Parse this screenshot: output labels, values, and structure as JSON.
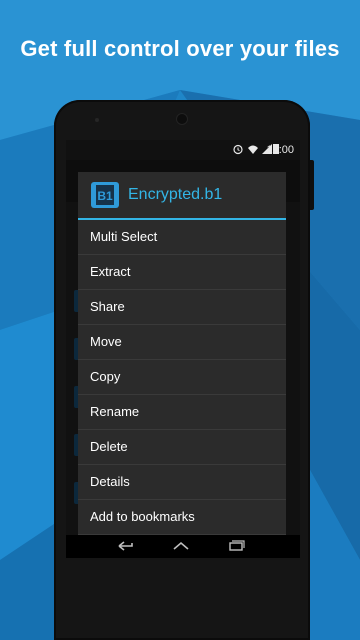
{
  "headline": "Get full control over your files",
  "status_bar": {
    "time": "10:00",
    "icons": [
      "alarm-icon",
      "wifi-icon",
      "signal-icon",
      "battery-icon"
    ]
  },
  "dialog": {
    "file_icon_text": "B1",
    "title": "Encrypted.b1",
    "menu_items": [
      "Multi Select",
      "Extract",
      "Share",
      "Move",
      "Copy",
      "Rename",
      "Delete",
      "Details",
      "Add to bookmarks"
    ]
  },
  "nav_bar": {
    "icons": [
      "back-icon",
      "home-icon",
      "recents-icon"
    ]
  },
  "colors": {
    "background": "#1f86c8",
    "accent": "#33b5e5",
    "dialog_bg": "#2b2b2b"
  }
}
